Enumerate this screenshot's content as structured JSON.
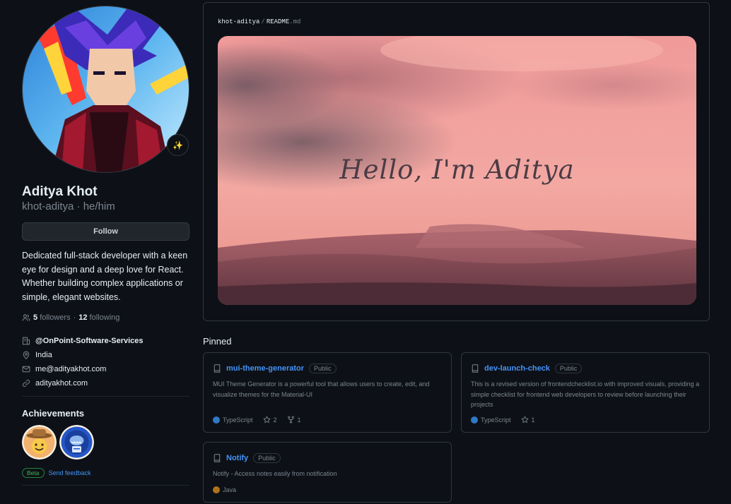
{
  "profile": {
    "name": "Aditya Khot",
    "username": "khot-aditya",
    "pronouns": "he/him",
    "status_emoji": "✨",
    "follow_label": "Follow",
    "bio": "Dedicated full-stack developer with a keen eye for design and a deep love for React. Whether building complex applications or simple, elegant websites.",
    "followers_count": "5",
    "followers_label": "followers",
    "following_count": "12",
    "following_label": "following",
    "organization": "@OnPoint-Software-Services",
    "location": "India",
    "email": "me@adityakhot.com",
    "website": "adityakhot.com"
  },
  "achievements": {
    "title": "Achievements",
    "beta_label": "Beta",
    "feedback_label": "Send feedback"
  },
  "readme": {
    "owner": "khot-aditya",
    "file": "README",
    "ext": ".md",
    "banner_text": "Hello, I'm Aditya"
  },
  "pinned": {
    "title": "Pinned",
    "repos": [
      {
        "name": "mui-theme-generator",
        "visibility": "Public",
        "description": "MUI Theme Generator is a powerful tool that allows users to create, edit, and visualize themes for the Material-UI",
        "language": "TypeScript",
        "language_color": "#3178c6",
        "stars": "2",
        "forks": "1"
      },
      {
        "name": "dev-launch-check",
        "visibility": "Public",
        "description": "This is a revised version of frontendchecklist.io with improved visuals, providing a simple checklist for frontend web developers to review before launching their projects",
        "language": "TypeScript",
        "language_color": "#3178c6",
        "stars": "1"
      },
      {
        "name": "Notify",
        "visibility": "Public",
        "description": "Notify - Access notes easily from notification",
        "language": "Java",
        "language_color": "#b07219"
      }
    ]
  },
  "icons": {
    "people": "people-icon",
    "organization": "organization-icon",
    "location": "location-icon",
    "mail": "mail-icon",
    "link": "link-icon",
    "repo": "repo-icon",
    "star": "star-icon",
    "fork": "fork-icon"
  }
}
